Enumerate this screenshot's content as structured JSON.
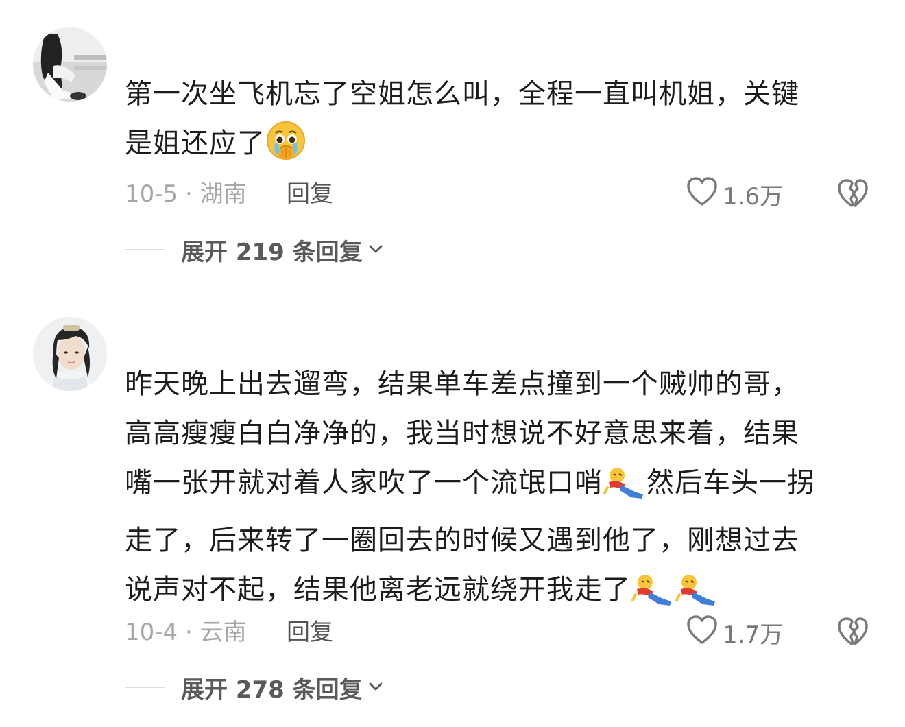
{
  "comments": [
    {
      "avatar_icon": "avatar-photo-girl-bw",
      "lines": [
        "第一次坐飞机忘了空姐怎么叫，全程一直叫机姐，关键",
        "是姐还应了"
      ],
      "emoji_icon": "pleading-crying-face-emoji",
      "date_location": "10-5 · 湖南",
      "reply_label": "回复",
      "like_icon": "heart-outline-icon",
      "likes": "1.6万",
      "dislike_icon": "broken-heart-icon",
      "expand_label": "展开 219 条回复",
      "expand_icon": "chevron-down-icon"
    },
    {
      "avatar_icon": "avatar-photo-young-man",
      "lines": [
        "昨天晚上出去遛弯，结果单车差点撞到一个贼帅的哥，",
        "高高瘦瘦白白净净的，我当时想说不好意思来着，结果",
        "嘴一张开就对着人家吹了一个流氓口哨",
        "然后车头一拐",
        "走了，后来转了一圈回去的时候又遇到他了，刚想过去",
        "说声对不起，结果他离老远就绕开我走了"
      ],
      "emoji_icon": "sliding-kneel-emoji",
      "date_location": "10-4 · 云南",
      "reply_label": "回复",
      "like_icon": "heart-outline-icon",
      "likes": "1.7万",
      "dislike_icon": "broken-heart-icon",
      "expand_label": "展开 278 条回复",
      "expand_icon": "chevron-down-icon"
    }
  ],
  "colors": {
    "text": "#1c1c1c",
    "meta": "#a7a7a7",
    "reply": "#555555",
    "expand": "#5a5a5a",
    "icon": "#7a7a7a",
    "divider": "#dddddd"
  }
}
